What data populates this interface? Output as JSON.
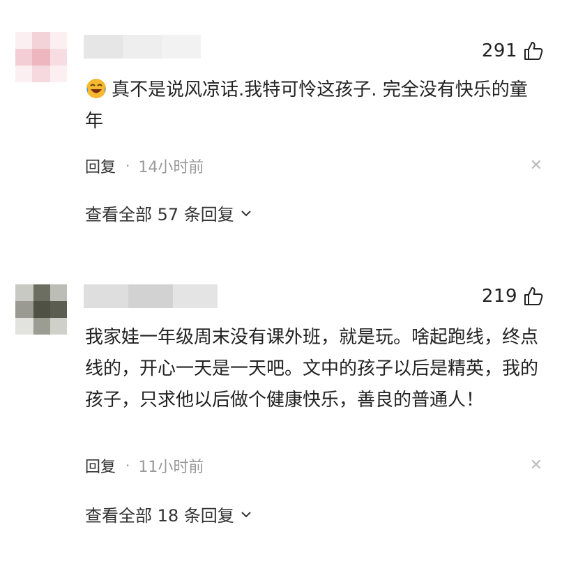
{
  "comments": [
    {
      "likes": "291",
      "text": "真不是说风凉话.我特可怜这孩子. 完全没有快乐的童年",
      "emoji": "crying-laughing-emoji",
      "reply_label": "回复",
      "separator": "·",
      "time": "14小时前",
      "view_all_label": "查看全部 57 条回复",
      "close_icon": "close-icon"
    },
    {
      "likes": "219",
      "text": "我家娃一年级周末没有课外班，就是玩。啥起跑线，终点线的，开心一天是一天吧。文中的孩子以后是精英，我的孩子，只求他以后做个健康快乐，善良的普通人！",
      "reply_label": "回复",
      "separator": "·",
      "time": "11小时前",
      "view_all_label": "查看全部 18 条回复",
      "close_icon": "close-icon"
    }
  ],
  "colors": {
    "text": "#222222",
    "secondary": "#999999",
    "close": "#bbbbbb"
  }
}
